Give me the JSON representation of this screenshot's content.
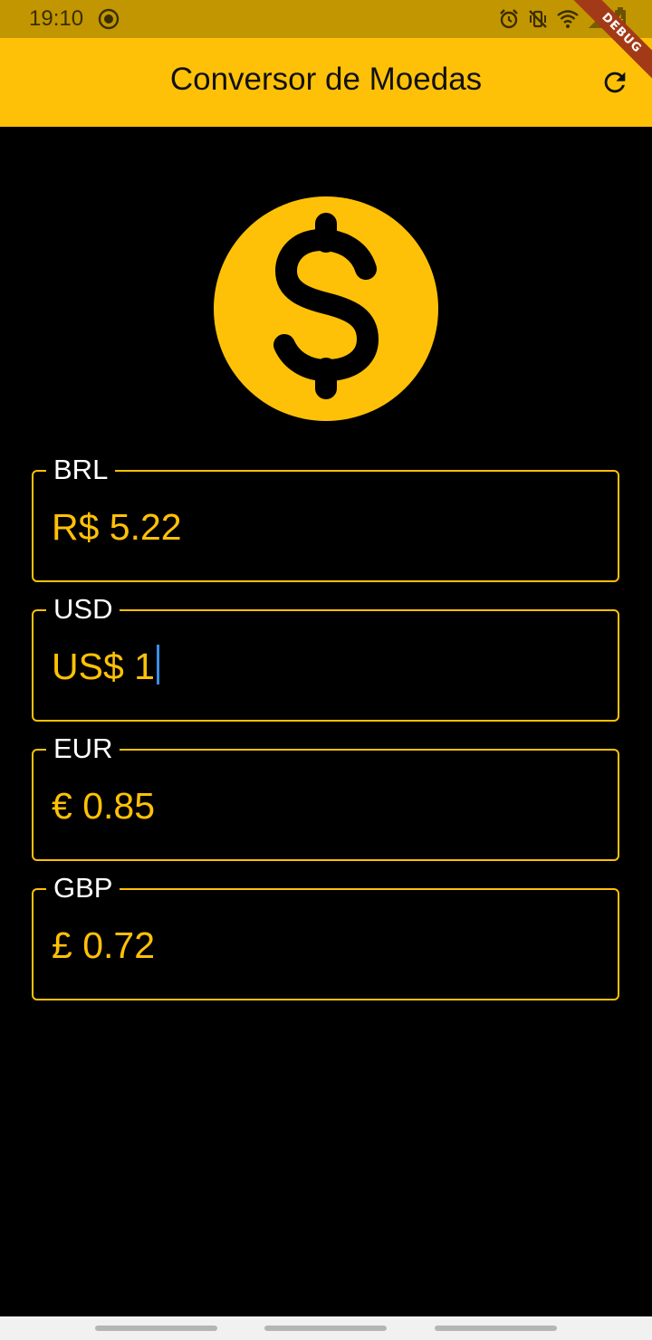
{
  "status_bar": {
    "time": "19:10",
    "icons": [
      "record-icon",
      "alarm-icon",
      "vibrate-off-icon",
      "wifi-icon",
      "signal-icon",
      "battery-charging-icon"
    ]
  },
  "debug_banner": {
    "label": "DEBUG"
  },
  "app_bar": {
    "title": "Conversor de Moedas",
    "refresh_icon": "refresh-icon"
  },
  "hero": {
    "icon": "dollar-coin-icon"
  },
  "fields": [
    {
      "label": "BRL",
      "value": "R$ 5.22",
      "focused": false
    },
    {
      "label": "USD",
      "value": "US$ 1",
      "focused": true
    },
    {
      "label": "EUR",
      "value": "€ 0.85",
      "focused": false
    },
    {
      "label": "GBP",
      "value": "£ 0.72",
      "focused": false
    }
  ],
  "colors": {
    "primary": "#FFC107",
    "status_bar": "#C29600",
    "background": "#000000",
    "cursor": "#3A8EE6",
    "debug_ribbon": "#A33A17"
  }
}
